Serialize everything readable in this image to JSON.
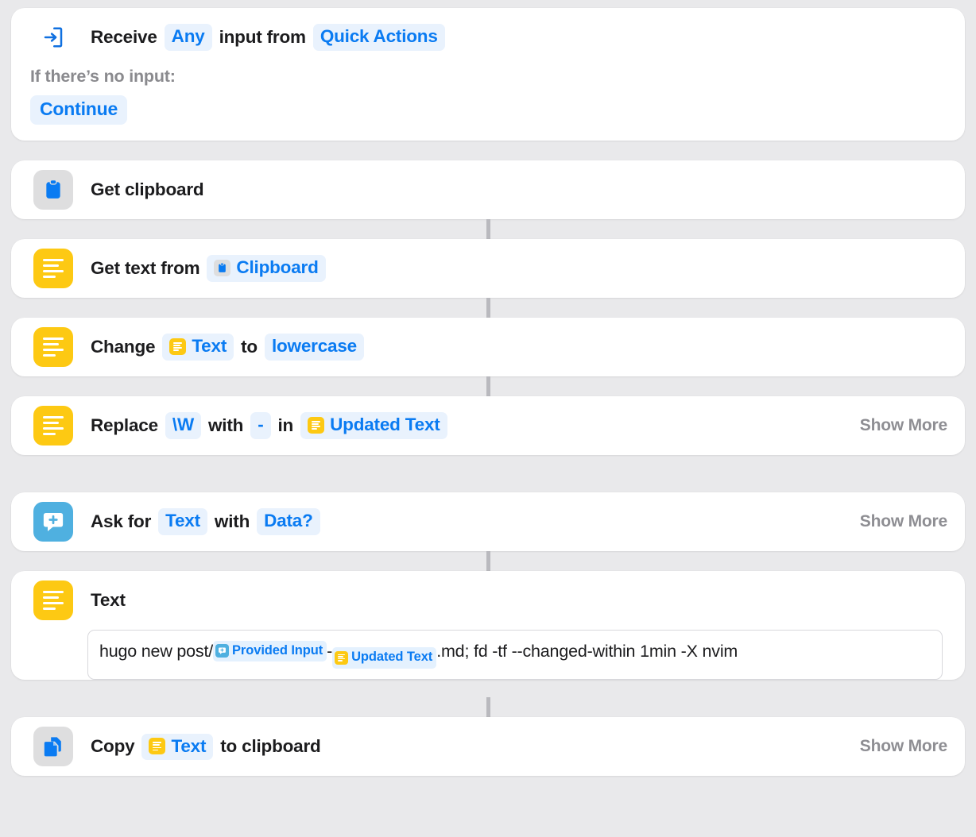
{
  "app": {
    "background_color": "#e9e9eb",
    "card_color": "#ffffff",
    "accent_blue": "#0a7bf2",
    "token_bg": "#e9f2fd",
    "yellow": "#fdc913",
    "skyblue": "#4fb0e0",
    "grey_icon_bg": "#dededf",
    "muted_text": "#8e8e93"
  },
  "common": {
    "show_more_label": "Show More"
  },
  "actions": [
    {
      "id": "receive-input",
      "icon": "receive-input-icon",
      "icon_style": "plain",
      "parts": [
        {
          "kind": "word",
          "text": "Receive"
        },
        {
          "kind": "token",
          "text": "Any"
        },
        {
          "kind": "word",
          "text": "input from"
        },
        {
          "kind": "token",
          "text": "Quick Actions"
        }
      ],
      "sub_label": "If there’s no input:",
      "sub_pill": "Continue",
      "show_more": false,
      "connector_after": "none"
    },
    {
      "id": "get-clipboard",
      "icon": "clipboard-icon",
      "icon_style": "grey",
      "parts": [
        {
          "kind": "word",
          "text": "Get clipboard"
        }
      ],
      "show_more": false,
      "connector_after": "line"
    },
    {
      "id": "get-text-from",
      "icon": "text-icon",
      "icon_style": "yellow",
      "parts": [
        {
          "kind": "word",
          "text": "Get text from"
        },
        {
          "kind": "token",
          "text": "Clipboard",
          "token_icon": "clipboard-icon",
          "token_icon_style": "grey"
        }
      ],
      "show_more": false,
      "connector_after": "line"
    },
    {
      "id": "change-case",
      "icon": "text-icon",
      "icon_style": "yellow",
      "parts": [
        {
          "kind": "word",
          "text": "Change"
        },
        {
          "kind": "token",
          "text": "Text",
          "token_icon": "text-icon",
          "token_icon_style": "yellow"
        },
        {
          "kind": "word",
          "text": "to"
        },
        {
          "kind": "token",
          "text": "lowercase"
        }
      ],
      "show_more": false,
      "connector_after": "line"
    },
    {
      "id": "replace-text",
      "icon": "text-icon",
      "icon_style": "yellow",
      "parts": [
        {
          "kind": "word",
          "text": "Replace"
        },
        {
          "kind": "token",
          "text": "\\W"
        },
        {
          "kind": "word",
          "text": "with"
        },
        {
          "kind": "token",
          "text": "-"
        },
        {
          "kind": "word",
          "text": "in"
        },
        {
          "kind": "token",
          "text": "Updated Text",
          "token_icon": "text-icon",
          "token_icon_style": "yellow"
        }
      ],
      "show_more": true,
      "connector_after": "gap"
    },
    {
      "id": "ask-for-input",
      "icon": "ask-input-icon",
      "icon_style": "skyblue",
      "parts": [
        {
          "kind": "word",
          "text": "Ask for"
        },
        {
          "kind": "token",
          "text": "Text"
        },
        {
          "kind": "word",
          "text": "with"
        },
        {
          "kind": "token",
          "text": "Data?"
        }
      ],
      "show_more": true,
      "connector_after": "line"
    },
    {
      "id": "text-block",
      "icon": "text-icon",
      "icon_style": "yellow",
      "parts": [
        {
          "kind": "word",
          "text": "Text"
        }
      ],
      "show_more": false,
      "body": {
        "segments": [
          {
            "kind": "plain",
            "text": "hugo new post/"
          },
          {
            "kind": "token",
            "text": "Provided Input",
            "token_icon": "ask-input-icon",
            "token_icon_style": "skyblue"
          },
          {
            "kind": "plain",
            "text": "-"
          },
          {
            "kind": "token",
            "text": "Updated Text",
            "token_icon": "text-icon",
            "token_icon_style": "yellow"
          },
          {
            "kind": "plain",
            "text": ".md; fd -tf --changed-within 1min -X nvim"
          }
        ],
        "full_text": "hugo new post/Provided Input-Updated Text.md; fd -tf --changed-within 1min -X nvim"
      },
      "connector_after": "line"
    },
    {
      "id": "copy-to-clipboard",
      "icon": "copy-icon",
      "icon_style": "grey",
      "parts": [
        {
          "kind": "word",
          "text": "Copy"
        },
        {
          "kind": "token",
          "text": "Text",
          "token_icon": "text-icon",
          "token_icon_style": "yellow"
        },
        {
          "kind": "word",
          "text": "to clipboard"
        }
      ],
      "show_more": true,
      "connector_after": "none"
    }
  ]
}
